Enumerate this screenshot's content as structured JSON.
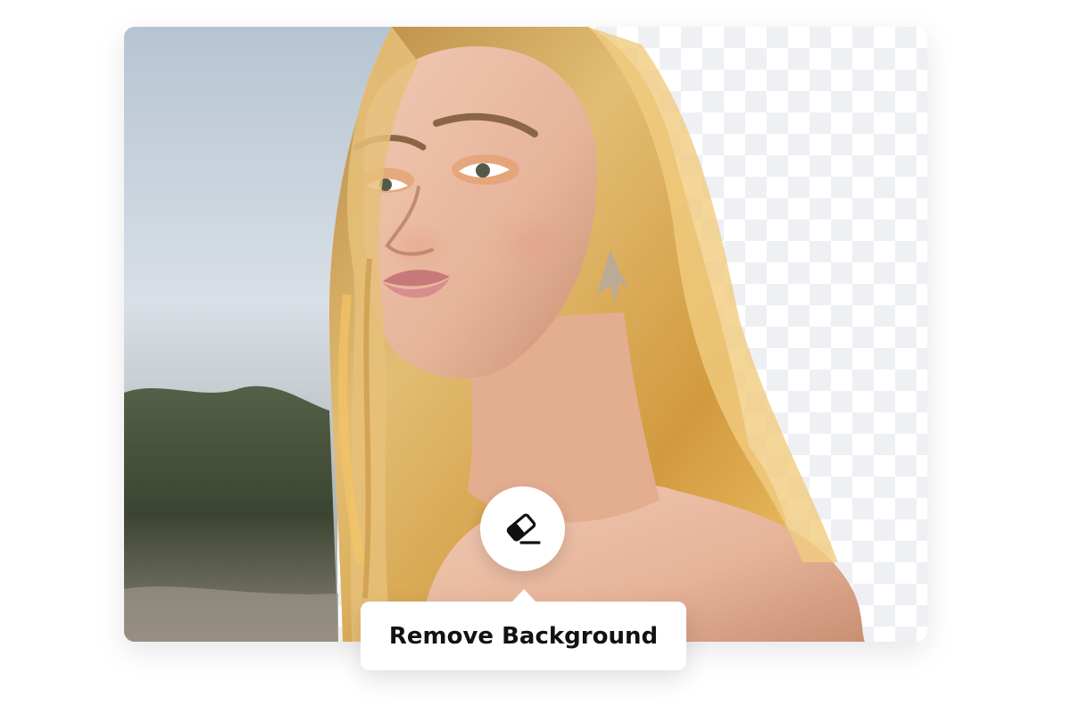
{
  "action": {
    "label": "Remove Background",
    "icon": "eraser-icon"
  },
  "photo": {
    "subject": "portrait-woman-blonde-hair",
    "background_removed_side": "right"
  },
  "colors": {
    "checker_light": "#ffffff",
    "checker_dark": "#eef0f3",
    "sky": "#c9d2dc",
    "foliage": "#3f4a33",
    "hair": "#d9aa5a",
    "skin": "#e9bba2"
  }
}
